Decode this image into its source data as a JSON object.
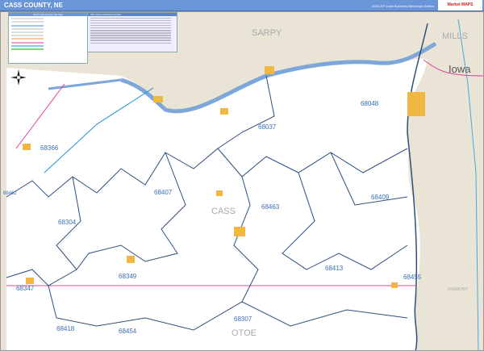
{
  "header": {
    "title": "CASS COUNTY, NE",
    "edition": "2020 ZIP Code Business Reference Edition",
    "logo": "Market MAPS"
  },
  "legend": {
    "title": "2020 Cass County, NE Map"
  },
  "zip_index": {
    "title": "ZIP Code Index/Grid Locator"
  },
  "map": {
    "counties": [
      "SARPY",
      "MILLS",
      "CASS",
      "OTOE",
      "FREMONT"
    ],
    "state": "Iowa",
    "zip_codes": [
      "68048",
      "68037",
      "68366",
      "68462",
      "68407",
      "68463",
      "68409",
      "68304",
      "68413",
      "68349",
      "68455",
      "68347",
      "68418",
      "68454",
      "68307"
    ],
    "colors": {
      "land": "#e9e4d6",
      "county": "#ffffff",
      "water": "#7da7d9",
      "boundary": "#2c4f7c",
      "highway": "#e0409a"
    }
  }
}
